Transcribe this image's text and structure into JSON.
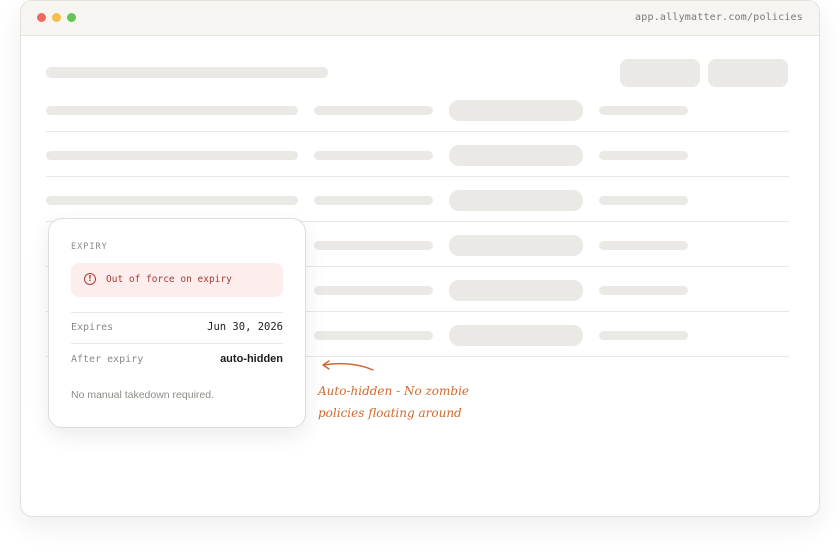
{
  "window": {
    "url": "app.allymatter.com/policies"
  },
  "expiry_card": {
    "section_label": "EXPIRY",
    "alert_text": "Out of force on expiry",
    "alert_icon": "alert-circle-icon",
    "rows": [
      {
        "key": "Expires",
        "value": "Jun 30, 2026"
      },
      {
        "key": "After expiry",
        "value": "auto-hidden"
      }
    ],
    "footnote": "No manual takedown required."
  },
  "annotation": {
    "line1": "Auto-hidden - No zombie",
    "line2": "policies floating around",
    "color": "#d1692f"
  },
  "colors": {
    "alert_bg": "#fdeeed",
    "alert_text": "#a93a34",
    "skeleton": "#ebe9e5"
  }
}
